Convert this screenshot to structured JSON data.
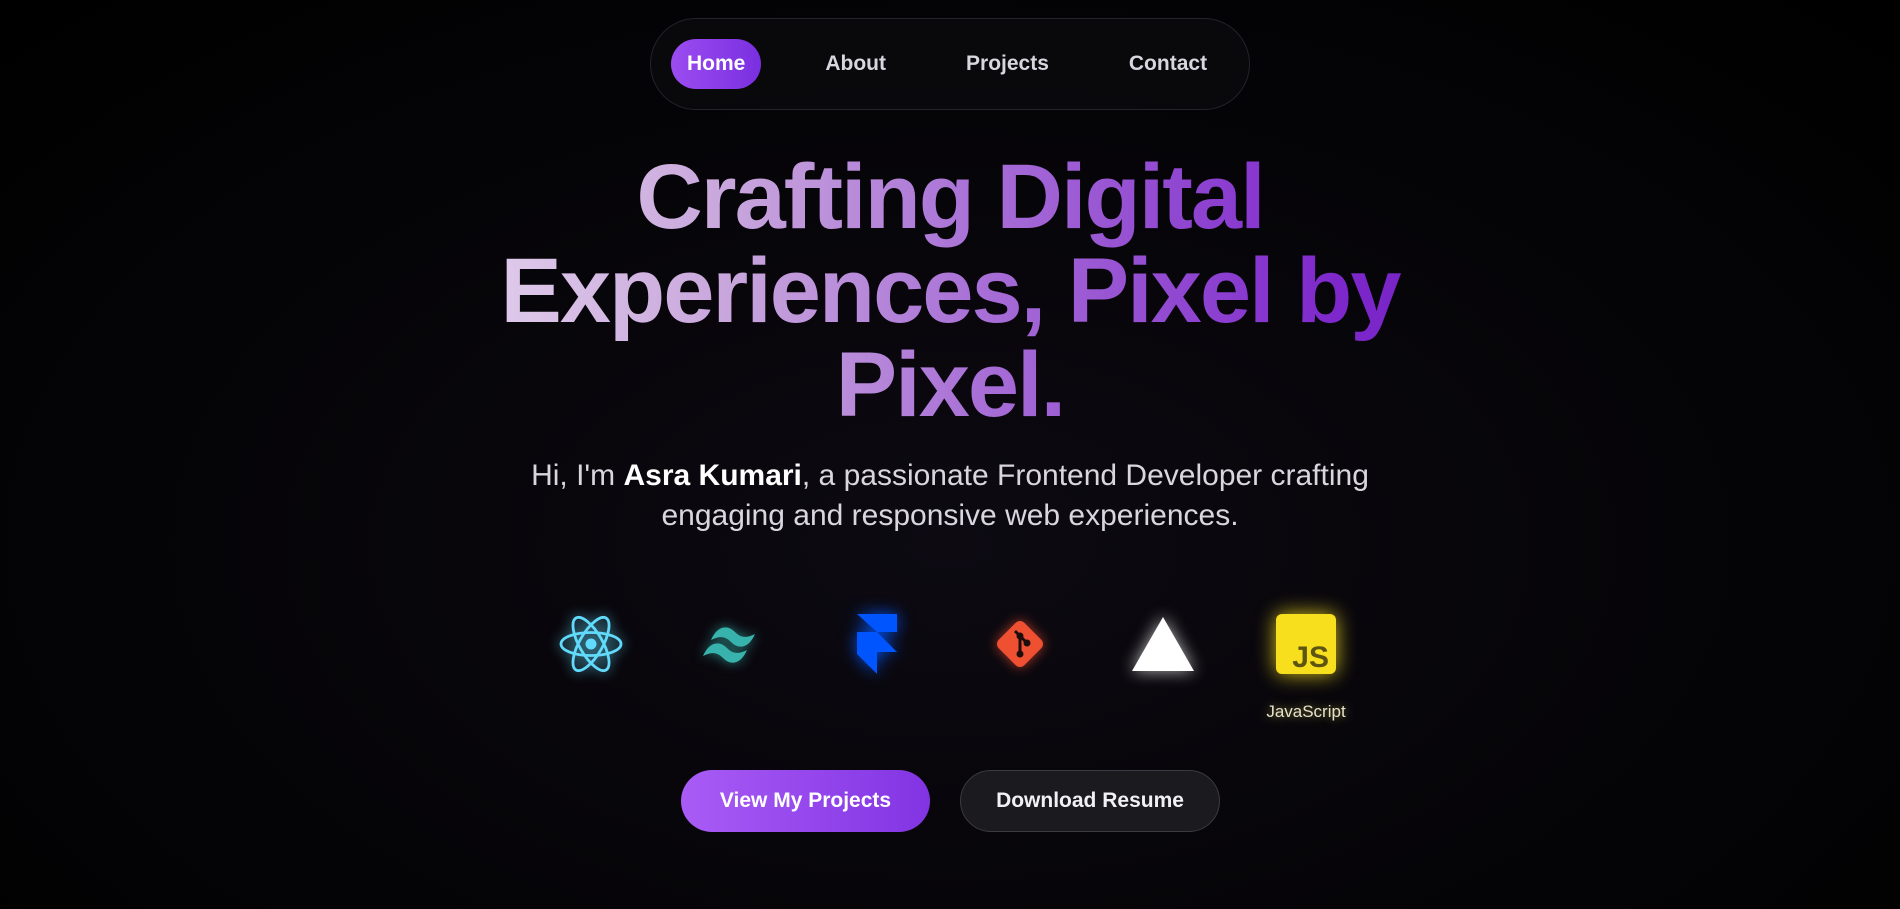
{
  "nav": {
    "items": [
      {
        "label": "Home",
        "active": true
      },
      {
        "label": "About",
        "active": false
      },
      {
        "label": "Projects",
        "active": false
      },
      {
        "label": "Contact",
        "active": false
      }
    ]
  },
  "hero": {
    "headline": "Crafting Digital Experiences, Pixel by Pixel.",
    "intro_prefix": "Hi, I'm ",
    "intro_name": "Asra Kumari",
    "intro_suffix": ", a passionate Frontend Developer crafting engaging and responsive web experiences."
  },
  "tech_stack": [
    {
      "icon": "react-icon",
      "color": "#61dafb"
    },
    {
      "icon": "tailwind-icon",
      "color": "#38b2ac"
    },
    {
      "icon": "framer-icon",
      "color": "#0055ff"
    },
    {
      "icon": "git-icon",
      "color": "#f05032"
    },
    {
      "icon": "vercel-icon",
      "color": "#ffffff"
    },
    {
      "icon": "javascript-icon",
      "color": "#f7df1e",
      "label": "JavaScript"
    }
  ],
  "buttons": {
    "primary": "View My Projects",
    "secondary": "Download Resume"
  },
  "colors": {
    "accent": "#9b4df0",
    "background": "#000000"
  }
}
